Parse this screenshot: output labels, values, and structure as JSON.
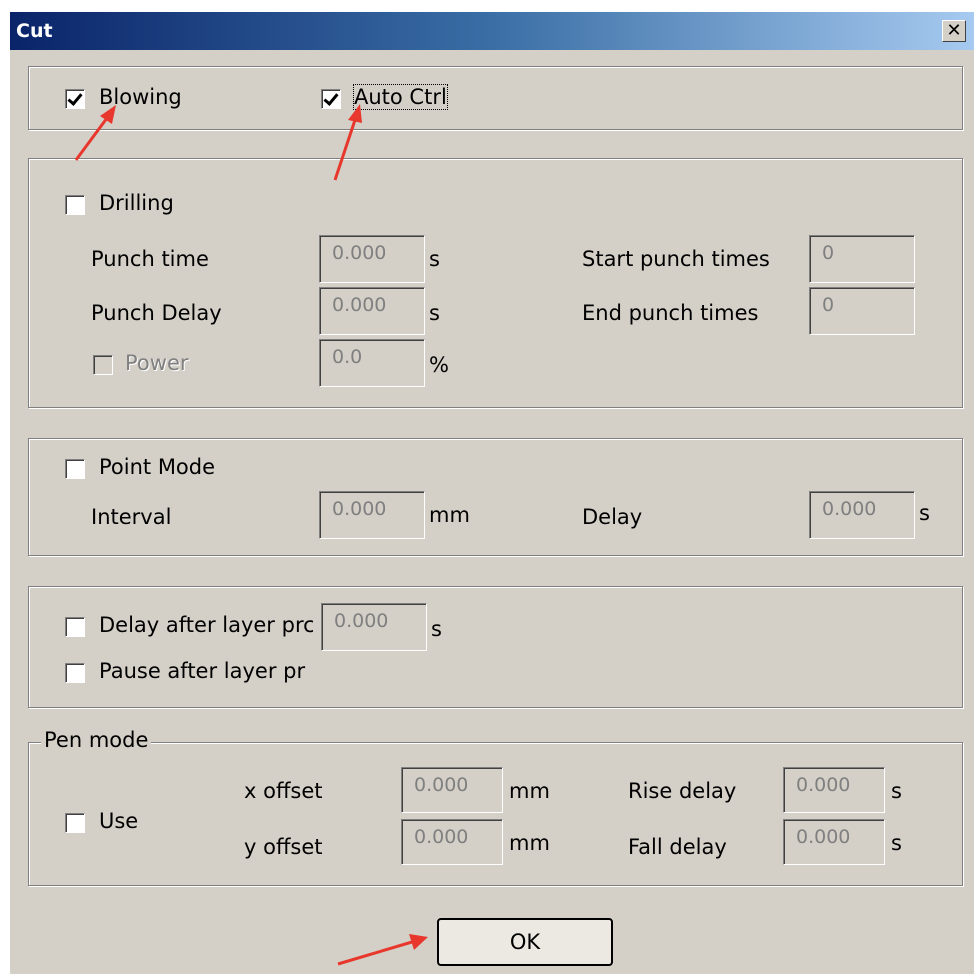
{
  "window": {
    "title": "Cut",
    "close_glyph": "✕"
  },
  "top_group": {
    "blowing": {
      "label": "Blowing",
      "checked": true
    },
    "auto_ctrl": {
      "label": "Auto Ctrl",
      "checked": true
    }
  },
  "drilling": {
    "label": "Drilling",
    "checked": false,
    "punch_time": {
      "label": "Punch time",
      "value": "0.000",
      "unit": "s"
    },
    "punch_delay": {
      "label": "Punch Delay",
      "value": "0.000",
      "unit": "s"
    },
    "power": {
      "label": "Power",
      "value": "0.0",
      "unit": "%",
      "checked": false,
      "enabled": false
    },
    "start_punch_times": {
      "label": "Start punch times",
      "value": "0"
    },
    "end_punch_times": {
      "label": "End punch times",
      "value": "0"
    }
  },
  "point_mode": {
    "label": "Point Mode",
    "checked": false,
    "interval": {
      "label": "Interval",
      "value": "0.000",
      "unit": "mm"
    },
    "delay": {
      "label": "Delay",
      "value": "0.000",
      "unit": "s"
    }
  },
  "layer": {
    "delay_after": {
      "label": "Delay after layer prc",
      "value": "0.000",
      "unit": "s",
      "checked": false
    },
    "pause_after": {
      "label": "Pause after layer pr",
      "checked": false
    }
  },
  "pen_mode": {
    "title": "Pen mode",
    "use": {
      "label": "Use",
      "checked": false
    },
    "x_offset": {
      "label": "x offset",
      "value": "0.000",
      "unit": "mm"
    },
    "y_offset": {
      "label": "y offset",
      "value": "0.000",
      "unit": "mm"
    },
    "rise_delay": {
      "label": "Rise delay",
      "value": "0.000",
      "unit": "s"
    },
    "fall_delay": {
      "label": "Fall delay",
      "value": "0.000",
      "unit": "s"
    }
  },
  "buttons": {
    "ok": "OK"
  },
  "colors": {
    "dialog_bg": "#d4d0c8",
    "title_start": "#0a246a",
    "title_end": "#a6caf0",
    "annotation_arrow": "#e8372c"
  }
}
